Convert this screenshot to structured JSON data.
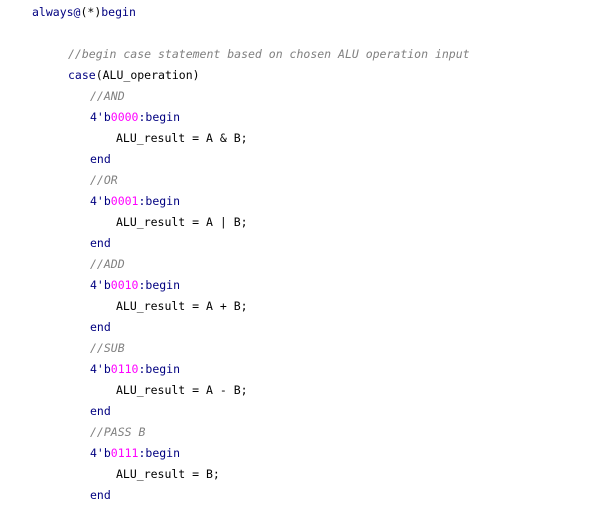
{
  "editor": {
    "lines": [
      {
        "kind": "tokens",
        "indent": 0,
        "tokens": [
          {
            "t": "always@",
            "c": "kw"
          },
          {
            "t": "(*)",
            "c": "plain"
          },
          {
            "t": "begin",
            "c": "kw"
          }
        ]
      },
      {
        "kind": "blank"
      },
      {
        "kind": "comment",
        "indent": 1,
        "text": "//begin case statement based on chosen ALU operation input"
      },
      {
        "kind": "tokens",
        "indent": 1,
        "tokens": [
          {
            "t": "case",
            "c": "kw"
          },
          {
            "t": "(ALU_operation)",
            "c": "plain"
          }
        ]
      },
      {
        "kind": "comment",
        "indent": 2,
        "text": "//AND"
      },
      {
        "kind": "tokens",
        "indent": 2,
        "tokens": [
          {
            "t": "4'b",
            "c": "kw"
          },
          {
            "t": "0000",
            "c": "num"
          },
          {
            "t": ":begin",
            "c": "kw"
          }
        ]
      },
      {
        "kind": "tokens",
        "indent": 3,
        "tokens": [
          {
            "t": "ALU_result = A & B;",
            "c": "plain"
          }
        ]
      },
      {
        "kind": "tokens",
        "indent": 2,
        "tokens": [
          {
            "t": "end",
            "c": "kw"
          }
        ]
      },
      {
        "kind": "comment",
        "indent": 2,
        "text": "//OR"
      },
      {
        "kind": "tokens",
        "indent": 2,
        "tokens": [
          {
            "t": "4'b",
            "c": "kw"
          },
          {
            "t": "0001",
            "c": "num"
          },
          {
            "t": ":begin",
            "c": "kw"
          }
        ]
      },
      {
        "kind": "tokens",
        "indent": 3,
        "tokens": [
          {
            "t": "ALU_result = A | B;",
            "c": "plain"
          }
        ]
      },
      {
        "kind": "tokens",
        "indent": 2,
        "tokens": [
          {
            "t": "end",
            "c": "kw"
          }
        ]
      },
      {
        "kind": "comment",
        "indent": 2,
        "text": "//ADD"
      },
      {
        "kind": "tokens",
        "indent": 2,
        "tokens": [
          {
            "t": "4'b",
            "c": "kw"
          },
          {
            "t": "0010",
            "c": "num"
          },
          {
            "t": ":begin",
            "c": "kw"
          }
        ]
      },
      {
        "kind": "tokens",
        "indent": 3,
        "tokens": [
          {
            "t": "ALU_result = A + B;",
            "c": "plain"
          }
        ]
      },
      {
        "kind": "tokens",
        "indent": 2,
        "tokens": [
          {
            "t": "end",
            "c": "kw"
          }
        ]
      },
      {
        "kind": "comment",
        "indent": 2,
        "text": "//SUB"
      },
      {
        "kind": "tokens",
        "indent": 2,
        "tokens": [
          {
            "t": "4'b",
            "c": "kw"
          },
          {
            "t": "0110",
            "c": "num"
          },
          {
            "t": ":begin",
            "c": "kw"
          }
        ]
      },
      {
        "kind": "tokens",
        "indent": 3,
        "tokens": [
          {
            "t": "ALU_result = A - B;",
            "c": "plain"
          }
        ]
      },
      {
        "kind": "tokens",
        "indent": 2,
        "tokens": [
          {
            "t": "end",
            "c": "kw"
          }
        ]
      },
      {
        "kind": "comment",
        "indent": 2,
        "text": "//PASS B"
      },
      {
        "kind": "tokens",
        "indent": 2,
        "tokens": [
          {
            "t": "4'b",
            "c": "kw"
          },
          {
            "t": "0111",
            "c": "num"
          },
          {
            "t": ":begin",
            "c": "kw"
          }
        ]
      },
      {
        "kind": "tokens",
        "indent": 3,
        "tokens": [
          {
            "t": "ALU_result = B;",
            "c": "plain"
          }
        ]
      },
      {
        "kind": "tokens",
        "indent": 2,
        "tokens": [
          {
            "t": "end",
            "c": "kw"
          }
        ]
      }
    ]
  }
}
